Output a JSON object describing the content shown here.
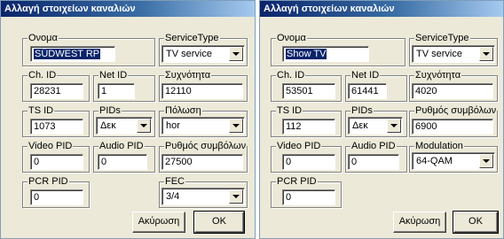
{
  "left": {
    "title": "Αλλαγή στοιχείων καναλιών",
    "name_label": "Ονομα",
    "name_value": "SÜDWEST RP",
    "service_type_label": "ServiceType",
    "service_type_value": "TV service",
    "ch_id_label": "Ch. ID",
    "ch_id_value": "28231",
    "net_id_label": "Net ID",
    "net_id_value": "1",
    "freq_label": "Συχνότητα",
    "freq_value": "12110",
    "ts_id_label": "TS ID",
    "ts_id_value": "1073",
    "pids_label": "PIDs",
    "pids_value": "Δεκ",
    "polar_label": "Πόλωση",
    "polar_value": "hor",
    "video_pid_label": "Video PID",
    "video_pid_value": "0",
    "audio_pid_label": "Audio PID",
    "audio_pid_value": "0",
    "symrate_label": "Ρυθμός συμβόλων",
    "symrate_value": "27500",
    "pcr_pid_label": "PCR PID",
    "pcr_pid_value": "0",
    "fec_label": "FEC",
    "fec_value": "3/4",
    "cancel_label": "Ακύρωση",
    "ok_label": "OK"
  },
  "right": {
    "title": "Αλλαγή στοιχείων καναλιών",
    "name_label": "Ονομα",
    "name_value": "Show TV",
    "service_type_label": "ServiceType",
    "service_type_value": "TV service",
    "ch_id_label": "Ch. ID",
    "ch_id_value": "53501",
    "net_id_label": "Net ID",
    "net_id_value": "61441",
    "freq_label": "Συχνότητα",
    "freq_value": "4020",
    "ts_id_label": "TS ID",
    "ts_id_value": "112",
    "pids_label": "PIDs",
    "pids_value": "Δεκ",
    "symrate_label": "Ρυθμός συμβόλων",
    "symrate_value": "6900",
    "video_pid_label": "Video PID",
    "video_pid_value": "0",
    "audio_pid_label": "Audio PID",
    "audio_pid_value": "0",
    "modulation_label": "Modulation",
    "modulation_value": "64-QAM",
    "pcr_pid_label": "PCR PID",
    "pcr_pid_value": "0",
    "cancel_label": "Ακύρωση",
    "ok_label": "OK"
  }
}
